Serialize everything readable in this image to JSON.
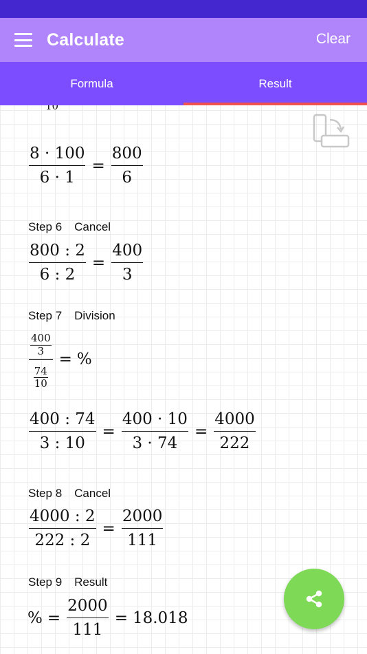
{
  "header": {
    "title": "Calculate",
    "clear_label": "Clear",
    "menu_icon": "menu-icon"
  },
  "tabs": [
    {
      "label": "Formula",
      "active": false
    },
    {
      "label": "Result",
      "active": true
    }
  ],
  "colors": {
    "status_bar": "#4527cf",
    "app_bar": "#b084fa",
    "tab_bar": "#7c4dff",
    "tab_indicator": "#f0524f",
    "share_button": "#7ed957"
  },
  "content": {
    "clipped_top": "10",
    "eq_a": {
      "n1": "8 · 100",
      "d1": "6 · 1",
      "eq": "=",
      "n2": "800",
      "d2": "6"
    },
    "step6": {
      "label": "Step 6",
      "title": "Cancel",
      "n1": "800 : 2",
      "d1": "6 : 2",
      "eq": "=",
      "n2": "400",
      "d2": "3"
    },
    "step7": {
      "label": "Step 7",
      "title": "Division",
      "a_num": "400",
      "a_den": "3",
      "b_num": "74",
      "b_den": "10",
      "eq": "=",
      "rhs": "%"
    },
    "eq_b": {
      "n1": "400 : 74",
      "d1": "3 : 10",
      "eq1": "=",
      "n2": "400 · 10",
      "d2": "3 · 74",
      "eq2": "=",
      "n3": "4000",
      "d3": "222"
    },
    "step8": {
      "label": "Step 8",
      "title": "Cancel",
      "n1": "4000 : 2",
      "d1": "222 : 2",
      "eq": "=",
      "n2": "2000",
      "d2": "111"
    },
    "step9": {
      "label": "Step 9",
      "title": "Result",
      "lhs": "%",
      "eq1": "=",
      "n": "2000",
      "d": "111",
      "eq2": "=",
      "value": "18.018"
    }
  },
  "icons": {
    "rotate": "rotate-screen-icon",
    "share": "share-icon"
  }
}
